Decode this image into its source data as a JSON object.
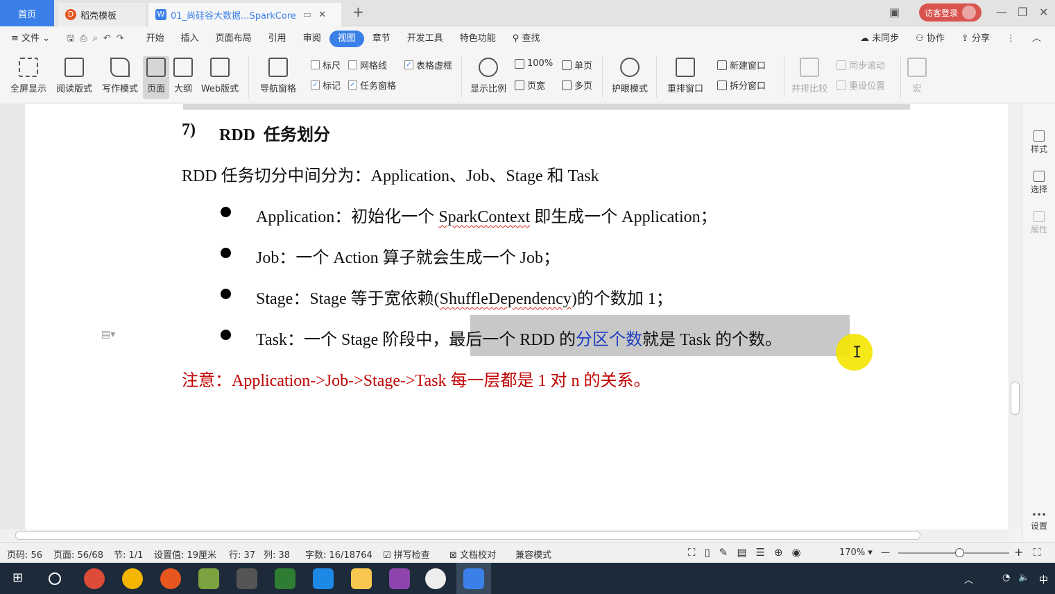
{
  "tabs": {
    "home": "首页",
    "template": "稻壳模板",
    "doc": "01_尚硅谷大数据...SparkCore"
  },
  "login": "访客登录",
  "menu": {
    "file": "文件",
    "items": [
      "开始",
      "插入",
      "页面布局",
      "引用",
      "审阅",
      "视图",
      "章节",
      "开发工具",
      "特色功能"
    ],
    "active": "视图",
    "search": "查找",
    "sync": "未同步",
    "collab": "协作",
    "share": "分享"
  },
  "toolbar": {
    "fullscreen": "全屏显示",
    "read": "阅读版式",
    "write": "写作模式",
    "page": "页面",
    "outline": "大纲",
    "web": "Web版式",
    "nav": "导航窗格",
    "ruler": "标尺",
    "gridlines": "网格线",
    "tablegrid": "表格虚框",
    "marks": "标记",
    "taskpane": "任务窗格",
    "zoomratio": "显示比例",
    "zoom100": "100%",
    "pagewidth": "页宽",
    "singlepage": "单页",
    "multipage": "多页",
    "eyecare": "护眼模式",
    "rearrange": "重排窗口",
    "newwin": "新建窗口",
    "splitwin": "拆分窗口",
    "sidebyside": "并排比较",
    "syncscroll": "同步滚动",
    "resetpos": "重设位置",
    "macro": "宏"
  },
  "doc": {
    "heading_num": "7)",
    "heading": "RDD  任务划分",
    "intro": "RDD 任务切分中间分为：Application、Job、Stage 和 Task",
    "b1_a": "Application：初始化一个 ",
    "b1_b": "SparkContext",
    "b1_c": " 即生成一个 Application；",
    "b2": "Job：一个 Action 算子就会生成一个 Job；",
    "b3_a": "Stage：Stage 等于宽依赖(",
    "b3_b": "ShuffleDependency",
    "b3_c": ")的个数加 1；",
    "b4_a": "Task：一个 Stage 阶段中，",
    "b4_b": "最后一个 RDD 的",
    "b4_c": "分区个数",
    "b4_d": "就是 Task 的个数。",
    "note": "注意：Application->Job->Stage->Task 每一层都是 1 对 n 的关系。"
  },
  "rpanel": {
    "style": "样式",
    "select": "选择",
    "props": "属性",
    "settings": "设置"
  },
  "status": {
    "pagecode": "页码: 56",
    "pages": "页面: 56/68",
    "section": "节: 1/1",
    "setting": "设置值: 19厘米",
    "row": "行: 37",
    "col": "列: 38",
    "words": "字数: 16/18764",
    "spell": "拼写检查",
    "proof": "文档校对",
    "compat": "兼容模式",
    "zoom": "170%"
  },
  "tray": {
    "ime": "中"
  }
}
